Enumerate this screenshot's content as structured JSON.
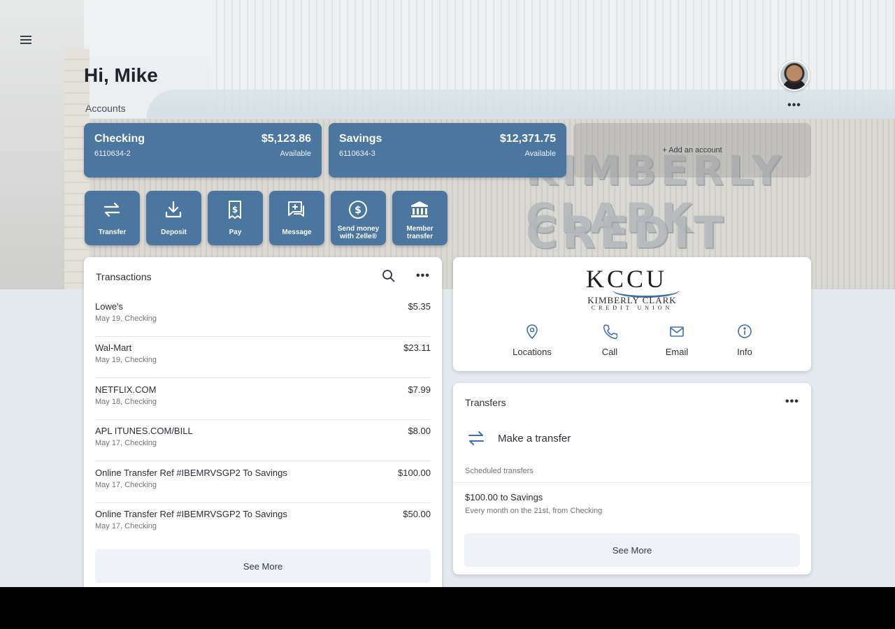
{
  "header": {
    "greeting": "Hi, Mike",
    "accounts_label": "Accounts",
    "more_label": "•••"
  },
  "accounts": [
    {
      "name": "Checking",
      "number": "6110634-2",
      "balance": "$5,123.86",
      "balance_label": "Available"
    },
    {
      "name": "Savings",
      "number": "6110634-3",
      "balance": "$12,371.75",
      "balance_label": "Available"
    }
  ],
  "add_account_label": "+ Add an account",
  "hero_sign": {
    "line1": "KIMBERLY CLARK",
    "line2": "CREDIT UNION"
  },
  "quick_actions": [
    {
      "label": "Transfer",
      "icon": "transfer-icon"
    },
    {
      "label": "Deposit",
      "icon": "deposit-icon"
    },
    {
      "label": "Pay",
      "icon": "pay-icon"
    },
    {
      "label": "Message",
      "icon": "message-icon"
    },
    {
      "label": "Send money with Zelle®",
      "icon": "zelle-icon"
    },
    {
      "label": "Member transfer",
      "icon": "bank-icon"
    }
  ],
  "transactions": {
    "title": "Transactions",
    "more_label": "•••",
    "items": [
      {
        "description": "Lowe's",
        "amount": "$5.35",
        "meta": "May 19, Checking"
      },
      {
        "description": "Wal-Mart",
        "amount": "$23.11",
        "meta": "May 19, Checking"
      },
      {
        "description": "NETFLIX.COM",
        "amount": "$7.99",
        "meta": "May 18, Checking"
      },
      {
        "description": "APL ITUNES.COM/BILL",
        "amount": "$8.00",
        "meta": "May 17, Checking"
      },
      {
        "description": "Online Transfer Ref #IBEMRVSGP2 To Savings",
        "amount": "$100.00",
        "meta": "May 17, Checking"
      },
      {
        "description": "Online Transfer Ref #IBEMRVSGP2 To Savings",
        "amount": "$50.00",
        "meta": "May 17, Checking"
      }
    ],
    "see_more": "See More"
  },
  "institution": {
    "logo_big": "KCCU",
    "logo_line1": "KIMBERLY CLARK",
    "logo_line2": "CREDIT UNION",
    "contacts": [
      {
        "label": "Locations",
        "icon": "location-pin-icon"
      },
      {
        "label": "Call",
        "icon": "phone-icon"
      },
      {
        "label": "Email",
        "icon": "email-icon"
      },
      {
        "label": "Info",
        "icon": "info-icon"
      }
    ]
  },
  "transfers": {
    "title": "Transfers",
    "more_label": "•••",
    "make_transfer": "Make a transfer",
    "scheduled_label": "Scheduled transfers",
    "scheduled": [
      {
        "title": "$100.00 to Savings",
        "subtitle": "Every month on the 21st, from Checking"
      }
    ],
    "see_more": "See More"
  },
  "colors": {
    "accent": "#4a76a0",
    "background": "#e4e8ef",
    "logo_blue": "#3e6fb1"
  }
}
